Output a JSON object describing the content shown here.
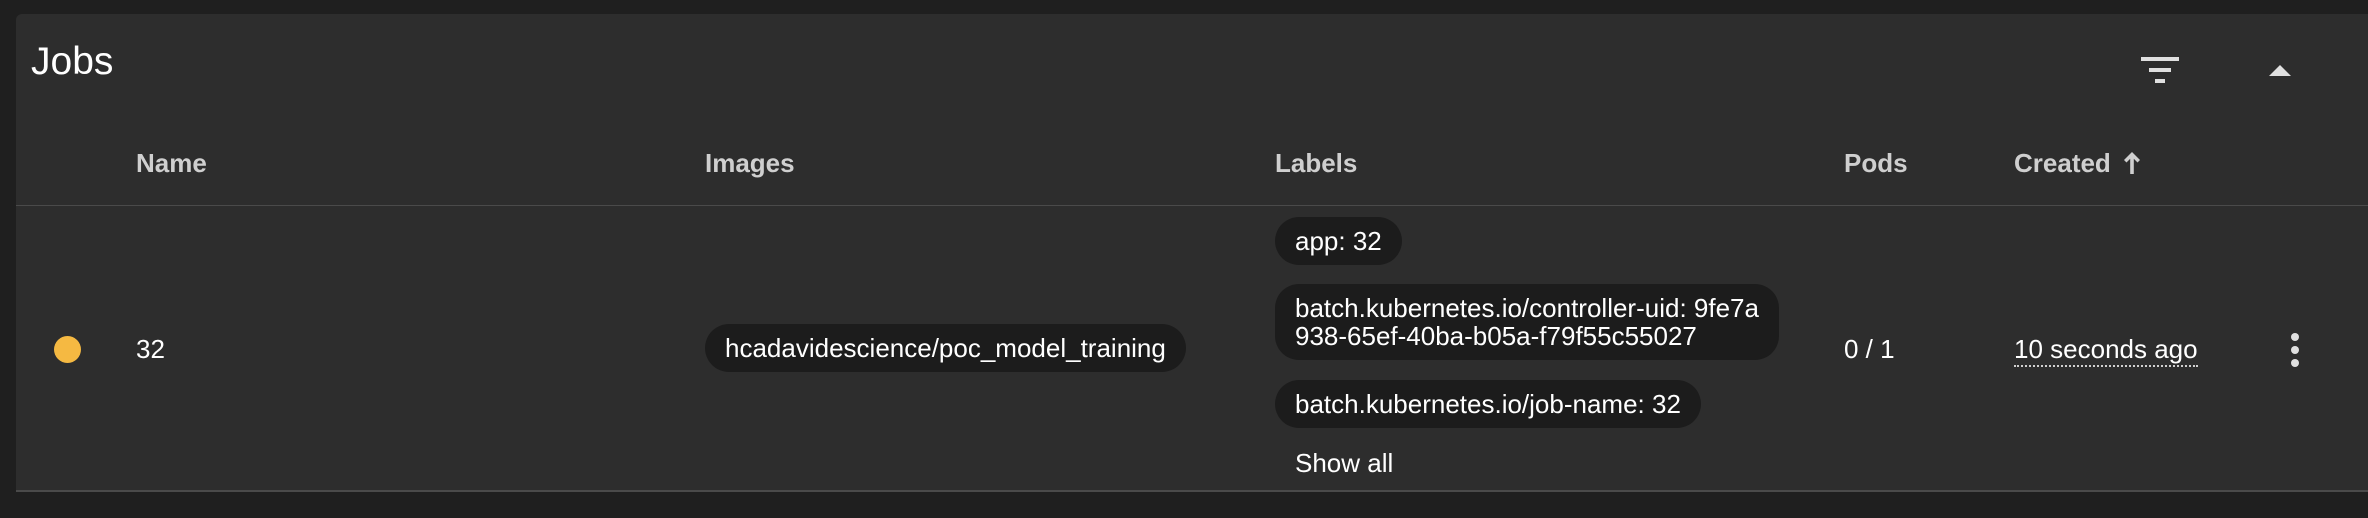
{
  "panel": {
    "title": "Jobs",
    "filter_icon": "filter-list-icon",
    "collapse_icon": "arrow-drop-up-icon"
  },
  "table": {
    "columns": {
      "name": "Name",
      "images": "Images",
      "labels": "Labels",
      "pods": "Pods",
      "created": "Created",
      "created_sort_icon": "arrow-up-icon"
    },
    "rows": [
      {
        "status_color": "#f5b942",
        "name": "32",
        "image": "hcadavidescience/poc_model_training",
        "labels": [
          "app: 32",
          "batch.kubernetes.io/controller-uid: 9fe7a938-65ef-40ba-b05a-f79f55c55027",
          "batch.kubernetes.io/job-name: 32"
        ],
        "labels_line_1": "batch.kubernetes.io/controller-uid: 9fe7a",
        "labels_line_2": "938-65ef-40ba-b05a-f79f55c55027",
        "show_all": "Show all",
        "pods": "0 / 1",
        "created": "10 seconds ago",
        "menu_icon": "more-vert-icon"
      }
    ]
  },
  "colors": {
    "accent": "#5d8ff0",
    "status_pending": "#f5b942",
    "background": "#1f1f1f",
    "card": "#2d2d2d",
    "chip": "#1c1c1c"
  }
}
